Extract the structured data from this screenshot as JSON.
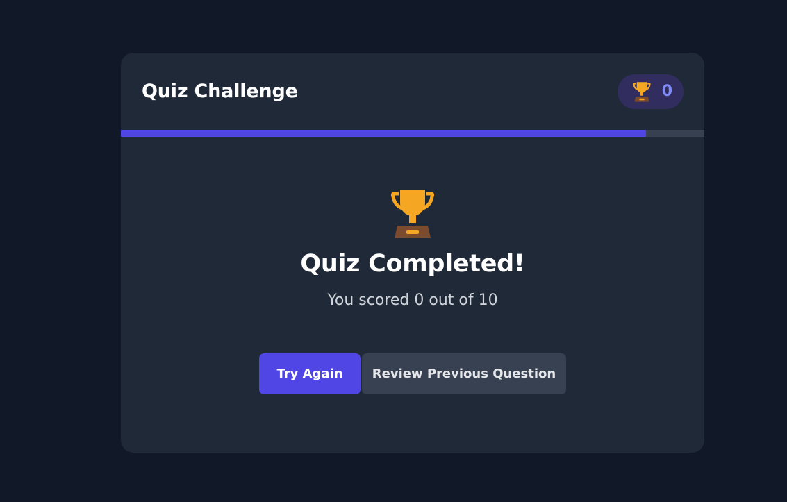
{
  "header": {
    "title": "Quiz Challenge",
    "score_badge": {
      "icon": "trophy-icon",
      "value": "0"
    }
  },
  "progress": {
    "fraction": 0.9
  },
  "result": {
    "icon": "trophy-icon",
    "title": "Quiz Completed!",
    "score_text": "You scored 0 out of 10"
  },
  "actions": {
    "try_again_label": "Try Again",
    "review_label": "Review Previous Question"
  },
  "colors": {
    "background": "#111827",
    "card": "#1f2937",
    "accent": "#4f46e5",
    "badge_bg": "#312e5f",
    "badge_text": "#818cf8",
    "secondary_button": "#374151"
  }
}
